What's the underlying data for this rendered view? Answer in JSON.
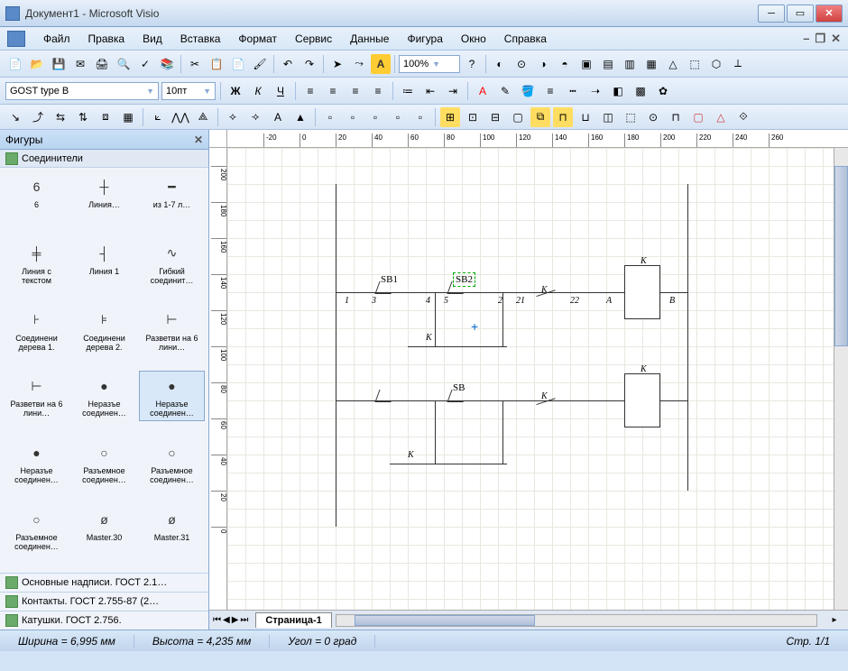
{
  "title": "Документ1 - Microsoft Visio",
  "menu": [
    "Файл",
    "Правка",
    "Вид",
    "Вставка",
    "Формат",
    "Сервис",
    "Данные",
    "Фигура",
    "Окно",
    "Справка"
  ],
  "font_name": "GOST type B",
  "font_size": "10пт",
  "zoom": "100%",
  "shapes_panel": {
    "title": "Фигуры",
    "stencil": "Соединители",
    "items": [
      "6",
      "Линия…",
      "из 1-7 л…",
      "Линия с текстом",
      "Линия 1",
      "Гибкий соединит…",
      "Соединени дерева 1.",
      "Соединени дерева 2.",
      "Разветви на 6 лини…",
      "Разветви на 6 лини…",
      "Неразъе соединен…",
      "Неразъе соединен…",
      "Неразъе соединен…",
      "Разъемное соединен…",
      "Разъемное соединен…",
      "Разъемное соединен…",
      "Master.30",
      "Master.31"
    ],
    "selected_index": 11,
    "other_stencils": [
      "Основные надписи. ГОСТ 2.1…",
      "Контакты. ГОСТ 2.755-87 (2…",
      "Катушки. ГОСТ 2.756."
    ]
  },
  "schematic": {
    "labels": {
      "sb1": "SB1",
      "sb2": "SB2",
      "sb": "SB",
      "k": "K",
      "nodes": [
        "1",
        "3",
        "4",
        "5",
        "2",
        "21",
        "22",
        "A",
        "B"
      ]
    }
  },
  "page_tab": "Страница-1",
  "status": {
    "width": "Ширина = 6,995 мм",
    "height": "Высота = 4,235 мм",
    "angle": "Угол = 0 град",
    "page": "Стр. 1/1"
  }
}
